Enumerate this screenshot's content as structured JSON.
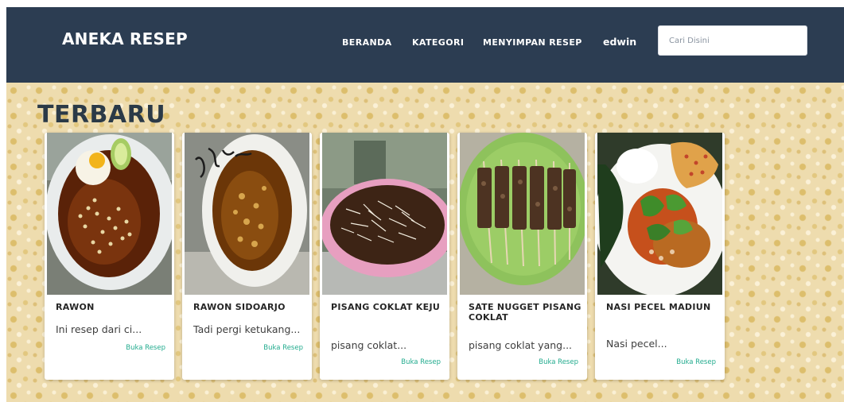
{
  "navbar": {
    "brand": "ANEKA RESEP",
    "links": [
      "BERANDA",
      "KATEGORI",
      "MENYIMPAN RESEP"
    ],
    "user": "edwin",
    "search_placeholder": "Cari Disini"
  },
  "section": {
    "title": "TERBARU"
  },
  "recipes": [
    {
      "title": "RAWON",
      "description": "Ini resep dari ci...",
      "link": "Buka Resep"
    },
    {
      "title": "RAWON SIDOARJO",
      "description": "Tadi pergi ketukang...",
      "link": "Buka Resep"
    },
    {
      "title": "PISANG COKLAT KEJU",
      "description": "pisang coklat...",
      "link": "Buka Resep"
    },
    {
      "title": "SATE NUGGET PISANG COKLAT",
      "description": "pisang coklat yang...",
      "link": "Buka Resep"
    },
    {
      "title": "NASI PECEL MADIUN",
      "description": "Nasi pecel...",
      "link": "Buka Resep"
    }
  ],
  "colors": {
    "navbar": "#2c3d52",
    "background_pattern": "#eedcae",
    "link_accent": "#22ab8e",
    "heading": "#2b3a47"
  }
}
